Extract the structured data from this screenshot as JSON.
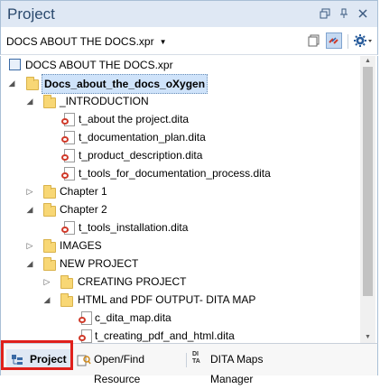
{
  "title": "Project",
  "title_buttons": [
    "restore-icon",
    "pin-icon",
    "close-icon"
  ],
  "toolbar": {
    "file_selector": "DOCS ABOUT THE DOCS.xpr",
    "buttons": [
      "collapse-all-icon",
      "link-with-editor-icon",
      "settings-icon"
    ]
  },
  "tree": [
    {
      "label": "DOCS ABOUT THE DOCS.xpr",
      "type": "project",
      "depth": 0
    },
    {
      "label": "Docs_about_the_docs_oXygen",
      "type": "folder",
      "depth": 0,
      "expanded": true,
      "selected": true
    },
    {
      "label": "_INTRODUCTION",
      "type": "folder",
      "depth": 1,
      "expanded": true
    },
    {
      "label": "t_about the project.dita",
      "type": "file",
      "depth": 2
    },
    {
      "label": "t_documentation_plan.dita",
      "type": "file",
      "depth": 2
    },
    {
      "label": "t_product_description.dita",
      "type": "file",
      "depth": 2
    },
    {
      "label": "t_tools_for_documentation_process.dita",
      "type": "file",
      "depth": 2
    },
    {
      "label": "Chapter 1",
      "type": "folder",
      "depth": 1,
      "expanded": false
    },
    {
      "label": "Chapter 2",
      "type": "folder",
      "depth": 1,
      "expanded": true
    },
    {
      "label": "t_tools_installation.dita",
      "type": "file",
      "depth": 2
    },
    {
      "label": "IMAGES",
      "type": "folder",
      "depth": 1,
      "expanded": false
    },
    {
      "label": "NEW PROJECT",
      "type": "folder",
      "depth": 1,
      "expanded": true
    },
    {
      "label": "CREATING PROJECT",
      "type": "folder",
      "depth": 2,
      "expanded": false
    },
    {
      "label": "HTML and PDF OUTPUT- DITA MAP",
      "type": "folder",
      "depth": 2,
      "expanded": true
    },
    {
      "label": "c_dita_map.dita",
      "type": "file",
      "depth": 3
    },
    {
      "label": "t_creating_pdf_and_html.dita",
      "type": "file",
      "depth": 3
    }
  ],
  "bottom_tabs": [
    {
      "label": "Project",
      "icon": "project-icon",
      "active": true
    },
    {
      "label": "Open/Find Resource",
      "icon": "open-find-icon",
      "active": false
    },
    {
      "label": "DITA Maps Manager",
      "icon": "dita-icon",
      "active": false
    }
  ],
  "colors": {
    "title_bg": "#dfe8f4",
    "selection": "#cfe3fa",
    "highlight": "#e0201b"
  }
}
